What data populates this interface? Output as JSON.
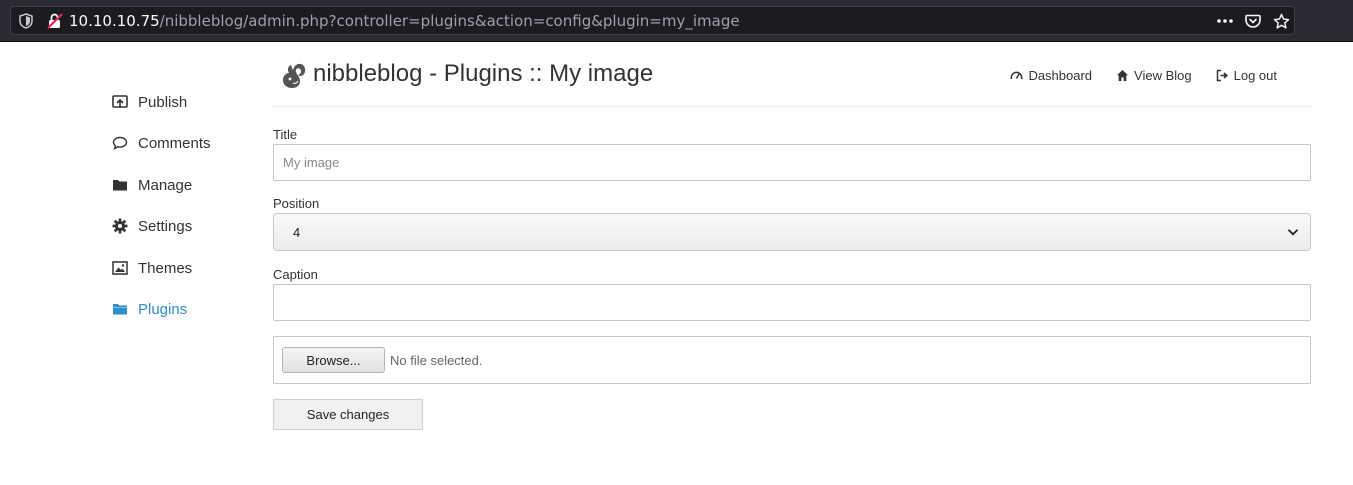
{
  "browser": {
    "url_host": "10.10.10.75",
    "url_path": "/nibbleblog/admin.php?controller=plugins&action=config&plugin=my_image",
    "icons": [
      "shield-icon",
      "insecure-lock-icon",
      "more-dots-icon",
      "pocket-icon",
      "bookmark-star-icon"
    ]
  },
  "sidebar": {
    "items": [
      {
        "label": "Publish",
        "icon": "publish-icon"
      },
      {
        "label": "Comments",
        "icon": "comment-icon"
      },
      {
        "label": "Manage",
        "icon": "folder-icon"
      },
      {
        "label": "Settings",
        "icon": "gear-icon"
      },
      {
        "label": "Themes",
        "icon": "image-icon"
      },
      {
        "label": "Plugins",
        "icon": "folder-open-icon",
        "active": true
      }
    ]
  },
  "header": {
    "title": "nibbleblog - Plugins :: My image",
    "nav": [
      {
        "label": "Dashboard",
        "icon": "dashboard-icon"
      },
      {
        "label": "View Blog",
        "icon": "home-icon"
      },
      {
        "label": "Log out",
        "icon": "logout-icon"
      }
    ]
  },
  "form": {
    "title_label": "Title",
    "title_value": "",
    "title_placeholder": "My image",
    "position_label": "Position",
    "position_value": "4",
    "caption_label": "Caption",
    "caption_value": "",
    "browse_label": "Browse...",
    "file_status": "No file selected.",
    "save_label": "Save changes"
  },
  "colors": {
    "accent": "#2e8ece",
    "text": "#333333",
    "browser_bg": "#2b2a33"
  }
}
